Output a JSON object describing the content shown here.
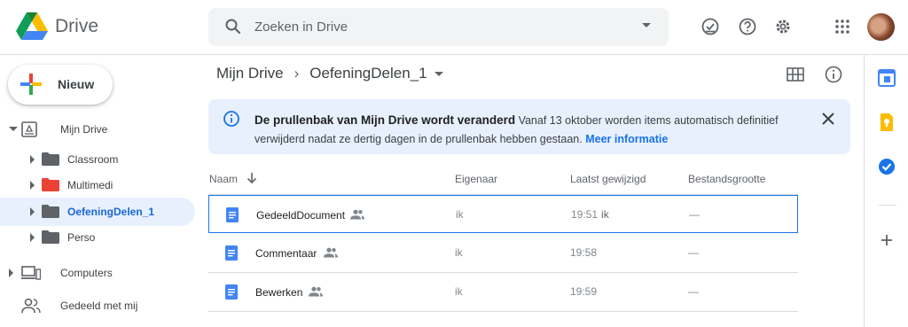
{
  "header": {
    "brand": "Drive",
    "search_placeholder": "Zoeken in Drive",
    "icons": [
      "offline-check-icon",
      "help-icon",
      "settings-icon",
      "apps-icon",
      "avatar"
    ]
  },
  "sidebar": {
    "new_label": "Nieuw",
    "items": [
      {
        "label": "Mijn Drive"
      },
      {
        "label": "Classroom",
        "color": "#5f6368"
      },
      {
        "label": "Multimedi",
        "color": "#ea4335"
      },
      {
        "label": "OefeningDelen_1",
        "color": "#5f6368"
      },
      {
        "label": "Perso",
        "color": "#5f6368"
      },
      {
        "label": "Computers"
      },
      {
        "label": "Gedeeld met mij"
      }
    ]
  },
  "breadcrumb": {
    "root": "Mijn Drive",
    "separator": "›",
    "current": "OefeningDelen_1"
  },
  "banner": {
    "title": "De prullenbak van Mijn Drive wordt veranderd",
    "body": "Vanaf 13 oktober worden items automatisch definitief verwijderd nadat ze dertig dagen in de prullenbak hebben gestaan.",
    "link": "Meer informatie"
  },
  "table": {
    "columns": {
      "name": "Naam",
      "owner": "Eigenaar",
      "modified": "Laatst gewijzigd",
      "size": "Bestandsgrootte"
    },
    "rows": [
      {
        "name": "GedeeldDocument",
        "owner": "ik",
        "modified": "19:51",
        "modified_by": "ik",
        "size": "—"
      },
      {
        "name": "Commentaar",
        "owner": "ik",
        "modified": "19:58",
        "modified_by": "",
        "size": "—"
      },
      {
        "name": "Bewerken",
        "owner": "ik",
        "modified": "19:59",
        "modified_by": "",
        "size": "—"
      }
    ]
  },
  "colors": {
    "accent": "#1a73e8",
    "selected_bg": "#e8f0fe",
    "doc_blue": "#4285f4"
  }
}
